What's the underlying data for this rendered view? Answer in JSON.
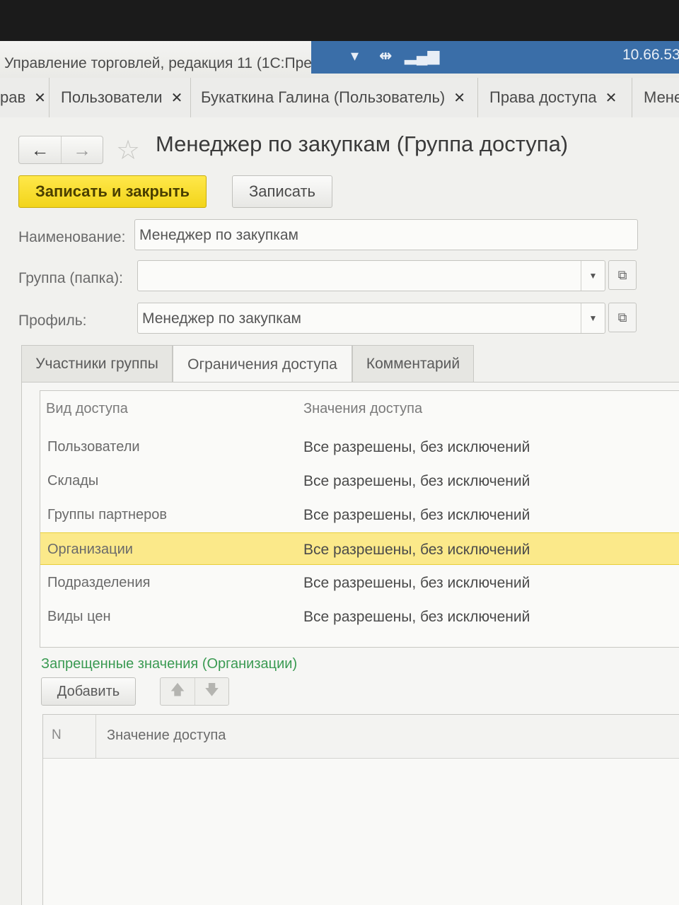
{
  "window": {
    "app_title": "Управление торговлей, редакция 11  (1С:Пре",
    "remote_ip": "10.66.53."
  },
  "tabs": [
    {
      "label": "рав"
    },
    {
      "label": "Пользователи"
    },
    {
      "label": "Букаткина Галина (Пользователь)"
    },
    {
      "label": "Права доступа"
    },
    {
      "label": "Мене"
    }
  ],
  "form": {
    "title": "Менеджер по закупкам (Группа доступа)",
    "save_close_label": "Записать и закрыть",
    "save_label": "Записать",
    "name_label": "Наименование:",
    "name_value": "Менеджер по закупкам",
    "group_label": "Группа (папка):",
    "group_value": "",
    "profile_label": "Профиль:",
    "profile_value": "Менеджер по закупкам"
  },
  "content_tabs": [
    {
      "label": "Участники группы"
    },
    {
      "label": "Ограничения доступа"
    },
    {
      "label": "Комментарий"
    }
  ],
  "access_table": {
    "col_kind": "Вид доступа",
    "col_values": "Значения доступа",
    "rows": [
      {
        "kind": "Пользователи",
        "value": "Все разрешены, без исключений"
      },
      {
        "kind": "Склады",
        "value": "Все разрешены, без исключений"
      },
      {
        "kind": "Группы партнеров",
        "value": "Все разрешены, без исключений"
      },
      {
        "kind": "Организации",
        "value": "Все разрешены, без исключений"
      },
      {
        "kind": "Подразделения",
        "value": "Все разрешены, без исключений"
      },
      {
        "kind": "Виды цен",
        "value": "Все разрешены, без исключений"
      }
    ],
    "selected_row": 3
  },
  "denied": {
    "title": "Запрещенные значения (Организации)",
    "add_label": "Добавить",
    "col_n": "N",
    "col_value": "Значение доступа"
  },
  "colors": {
    "accent_yellow": "#f2d41a",
    "selection": "#fbe98a",
    "group_title_green": "#3a9a52",
    "remote_bar": "#3a6ea8"
  }
}
